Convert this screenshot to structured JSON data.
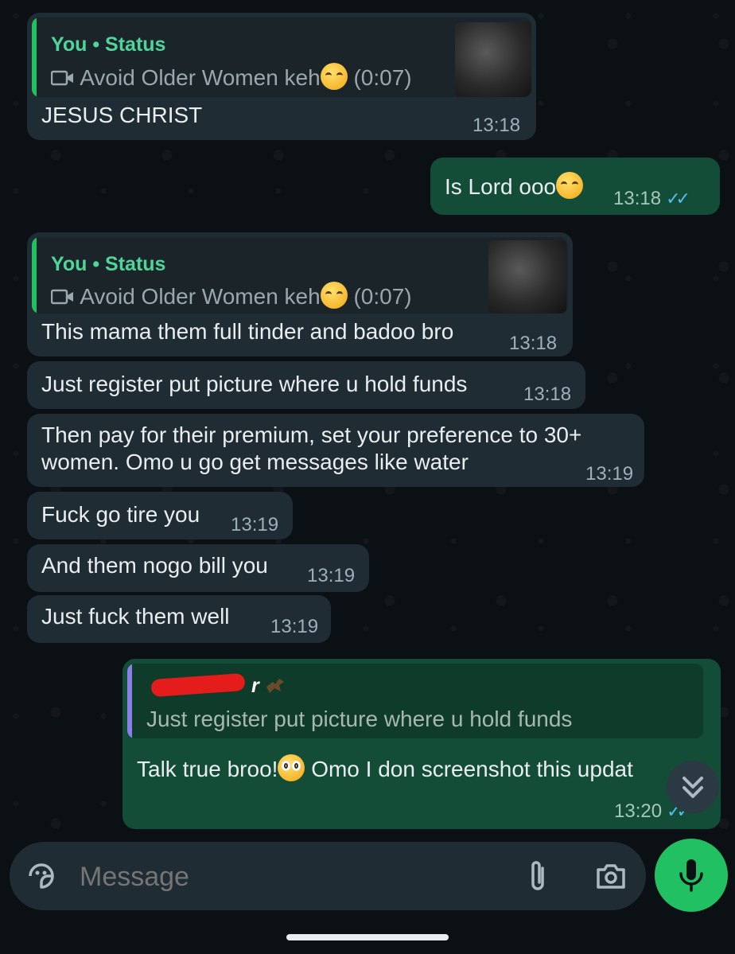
{
  "messages": [
    {
      "quote_author": "You",
      "quote_sep": "•",
      "quote_type": "Status",
      "quote_text": "Avoid Older Women keh",
      "quote_duration": "(0:07)",
      "text": "JESUS CHRIST",
      "time": "13:18"
    },
    {
      "text": "Is Lord ooo",
      "time": "13:18"
    },
    {
      "quote_author": "You",
      "quote_sep": "•",
      "quote_type": "Status",
      "quote_text": "Avoid Older Women keh",
      "quote_duration": "(0:07)",
      "text": "This mama them full tinder and badoo bro",
      "time": "13:18"
    },
    {
      "text": "Just register put picture where u hold funds",
      "time": "13:18"
    },
    {
      "text_line1": "Then pay for their premium, set your preference to 30+",
      "text_line2": "women.  Omo u go get messages like water",
      "time": "13:19"
    },
    {
      "text": "Fuck go tire you",
      "time": "13:19"
    },
    {
      "text": "And them nogo bill you",
      "time": "13:19"
    },
    {
      "text": "Just fuck them well",
      "time": "13:19"
    },
    {
      "quote_author_visible": "r",
      "quote_text": "Just register put picture where u hold funds",
      "text_part1": "Talk true broo!",
      "text_part2": "Omo I don screenshot this updat",
      "time": "13:20"
    }
  ],
  "composer": {
    "placeholder": "Message"
  },
  "icons": {
    "video": "video-camera-icon",
    "sticker": "sticker-icon",
    "attach": "paperclip-icon",
    "camera": "camera-icon",
    "mic": "microphone-icon",
    "scroll": "double-chevron-down-icon",
    "read": "double-check-icon"
  },
  "colors": {
    "incoming": "#1f2c34",
    "outgoing": "#134d37",
    "accent": "#21c063",
    "quote_bar_status": "#21c063",
    "quote_bar_reply": "#8b7fe8",
    "read_ticks": "#53bdeb"
  }
}
